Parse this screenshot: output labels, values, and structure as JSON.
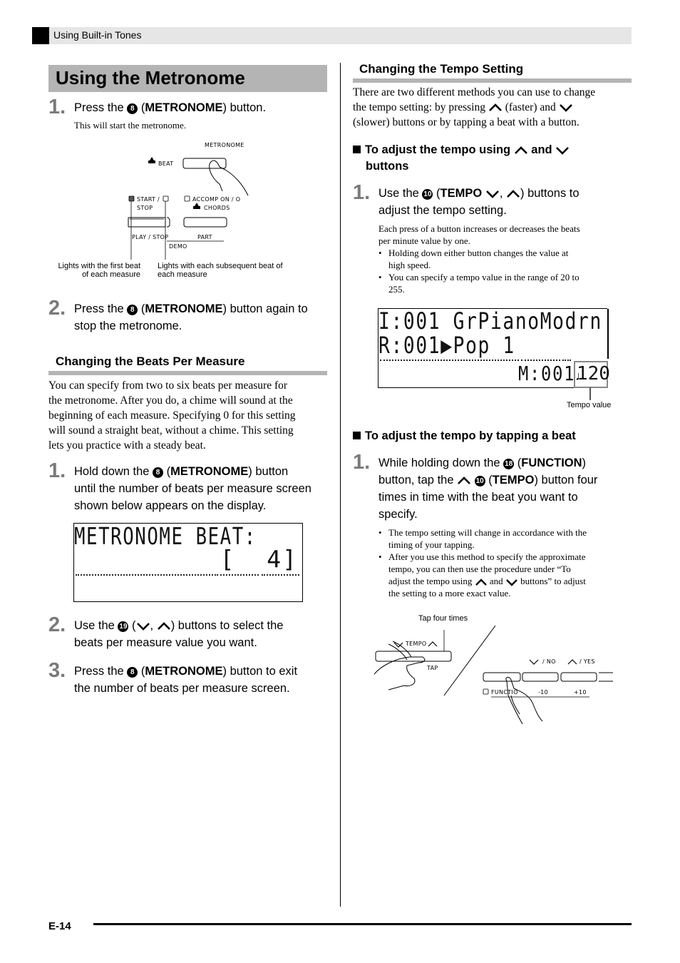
{
  "header": {
    "section": "Using Built-in Tones"
  },
  "title": "Using the Metronome",
  "left": {
    "steps_start": [
      {
        "num": "1.",
        "pre": "Press the ",
        "ref": "8",
        "paren_open": " (",
        "bold": "METRONOME",
        "post": ") button.",
        "note": "This will start the metronome."
      },
      {
        "num": "2.",
        "pre": "Press the ",
        "ref": "8",
        "paren_open": " (",
        "bold": "METRONOME",
        "post": ") button again to",
        "line2": "stop the metronome."
      }
    ],
    "diagram": {
      "metronome_label": "METRONOME",
      "beat_label": "BEAT",
      "start_stop_label1": "START /",
      "start_stop_label2": "STOP",
      "accomp_label": "ACCOMP ON / O",
      "chords_label": "CHORDS",
      "play_stop_label": "PLAY / STOP",
      "part_label": "PART",
      "demo_label": "DEMO",
      "caption_first_line1": "Lights with the first beat",
      "caption_first_line2": "of each measure",
      "caption_each_line1": "Lights with each subsequent beat of",
      "caption_each_line2": "each measure"
    },
    "beats_section": {
      "heading": "Changing the Beats Per Measure",
      "body": [
        "You can specify from two to six beats per measure for",
        "the metronome. After you do, a chime will sound at the",
        "beginning of each measure. Specifying 0 for this setting",
        "will sound a straight beat, without a chime. This setting",
        "lets you practice with a steady beat."
      ],
      "step1": {
        "num": "1.",
        "pre": "Hold down the ",
        "ref": "8",
        "bold": "METRONOME",
        "post": ") button",
        "line2": "until the number of beats per measure screen",
        "line3": "shown below appears on the display."
      },
      "lcd": {
        "line1": "METRONOME BEAT:",
        "line2": "[  4]"
      },
      "step2": {
        "num": "2.",
        "pre": "Use the ",
        "ref": "19",
        "post": ") buttons to select the",
        "line2": "beats per measure value you want."
      },
      "step3": {
        "num": "3.",
        "pre": "Press the ",
        "ref": "8",
        "bold": "METRONOME",
        "post": ") button to exit",
        "line2": "the number of beats per measure screen."
      }
    }
  },
  "right": {
    "tempo_section": {
      "heading": "Changing the Tempo Setting",
      "intro_l1": "There are two different methods you can use to change",
      "intro_l2a": "the tempo setting: by pressing ",
      "intro_l2b": " (faster) and ",
      "intro_l3": "(slower) buttons or by tapping a beat with a button.",
      "sub1_a": "To adjust the tempo using ",
      "sub1_b": " and ",
      "sub1_c": "buttons",
      "step1": {
        "num": "1.",
        "pre": "Use the ",
        "ref": "10",
        "bold": "TEMPO",
        "post": ") buttons to",
        "line2": "adjust the tempo setting."
      },
      "note_l1": "Each press of a button increases or decreases the beats",
      "note_l2": "per minute value by one.",
      "bullets": [
        [
          "Holding down either button changes the value at",
          "high speed."
        ],
        [
          "You can specify a tempo value in the range of 20 to",
          "255."
        ]
      ],
      "lcd": {
        "line1": "I:001 GrPianoModrn",
        "line2": "R:001▶Pop 1",
        "measure": "M:001",
        "tempo": "120"
      },
      "tempo_caption": "Tempo value",
      "sub2": "To adjust the tempo by tapping a beat",
      "step_tap": {
        "num": "1.",
        "pre": "While holding down the ",
        "ref": "18",
        "bold": "FUNCTION",
        "post": ")",
        "l2a": "button, tap the ",
        "ref2": "10",
        "bold2": "TEMPO",
        "l2b": ") button four",
        "line3": "times in time with the beat you want to",
        "line4": "specify."
      },
      "tap_bullets": [
        [
          "The tempo setting will change in accordance with the",
          "timing of your tapping."
        ],
        [
          "After you use this method to specify the approximate",
          "tempo, you can then use the procedure under “To"
        ]
      ],
      "tap_b2_l3a": "adjust the tempo using ",
      "tap_b2_l3b": " and ",
      "tap_b2_l3c": " buttons” to adjust",
      "tap_b2_l4": "the setting to a more exact value.",
      "diagram": {
        "tap_caption": "Tap four times",
        "tempo_label": "TEMPO",
        "tap_label": "TAP",
        "no_label": "/ NO",
        "yes_label": "/ YES",
        "function_label": "FUNCTIO",
        "minus10": "-10",
        "plus10": "+10"
      }
    }
  },
  "footer": {
    "page": "E-14"
  }
}
